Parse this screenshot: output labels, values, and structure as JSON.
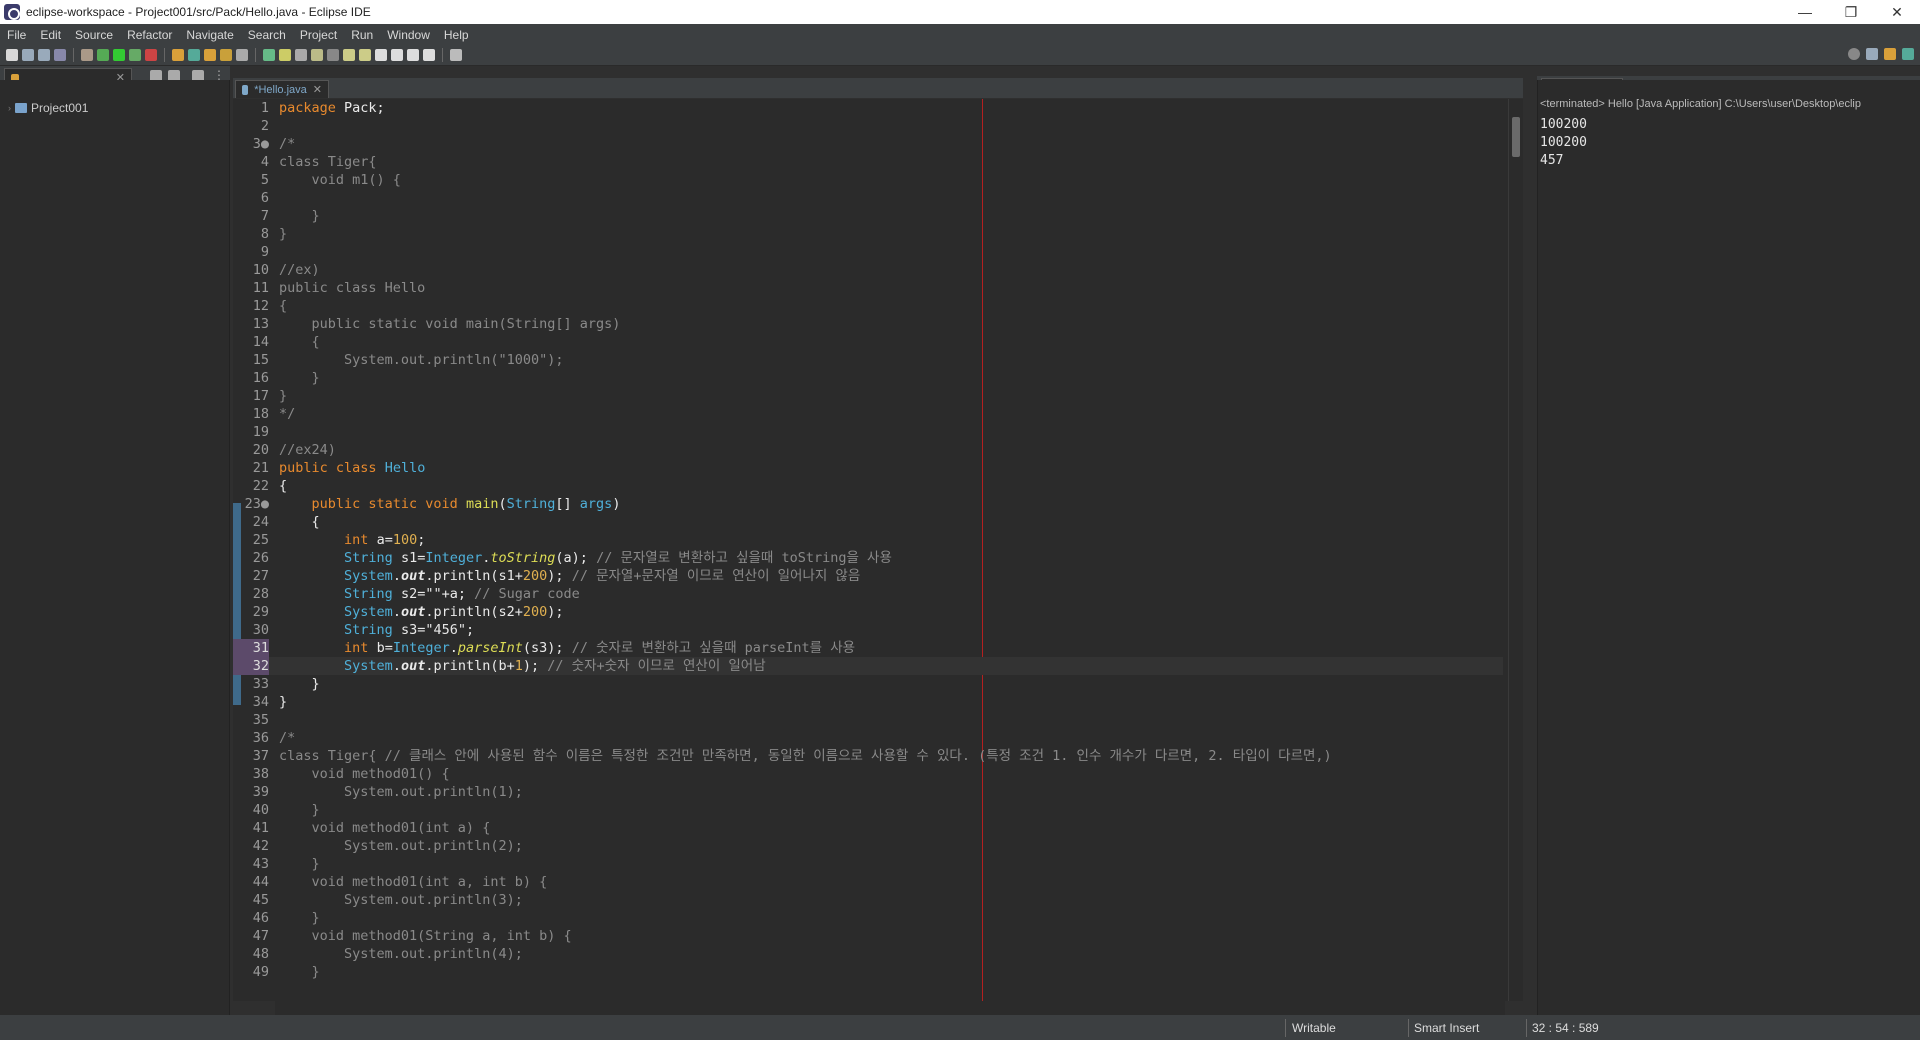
{
  "window": {
    "title": "eclipse-workspace - Project001/src/Pack/Hello.java - Eclipse IDE",
    "minimize": "—",
    "restore": "❐",
    "close": "✕"
  },
  "menu": [
    "File",
    "Edit",
    "Source",
    "Refactor",
    "Navigate",
    "Search",
    "Project",
    "Run",
    "Window",
    "Help"
  ],
  "explorer": {
    "project": "Project001"
  },
  "editor": {
    "tab_label": "*Hello.java"
  },
  "code": [
    {
      "n": "1",
      "t": "package Pack;"
    },
    {
      "n": "2",
      "t": ""
    },
    {
      "n": "3●",
      "t": "/*"
    },
    {
      "n": "4",
      "t": "class Tiger{"
    },
    {
      "n": "5",
      "t": "    void m1() {"
    },
    {
      "n": "6",
      "t": ""
    },
    {
      "n": "7",
      "t": "    }"
    },
    {
      "n": "8",
      "t": "}"
    },
    {
      "n": "9",
      "t": ""
    },
    {
      "n": "10",
      "t": "//ex)"
    },
    {
      "n": "11",
      "t": "public class Hello"
    },
    {
      "n": "12",
      "t": "{"
    },
    {
      "n": "13",
      "t": "    public static void main(String[] args)"
    },
    {
      "n": "14",
      "t": "    {"
    },
    {
      "n": "15",
      "t": "        System.out.println(\"1000\");"
    },
    {
      "n": "16",
      "t": "    }"
    },
    {
      "n": "17",
      "t": "}"
    },
    {
      "n": "18",
      "t": "*/"
    },
    {
      "n": "19",
      "t": ""
    },
    {
      "n": "20",
      "t": "//ex24)"
    },
    {
      "n": "21",
      "t": "public class Hello"
    },
    {
      "n": "22",
      "t": "{"
    },
    {
      "n": "23●",
      "t": "    public static void main(String[] args)"
    },
    {
      "n": "24",
      "t": "    {"
    },
    {
      "n": "25",
      "t": "        int a=100;"
    },
    {
      "n": "26",
      "t": "        String s1=Integer.toString(a); // 문자열로 변환하고 싶을때 toString을 사용"
    },
    {
      "n": "27",
      "t": "        System.out.println(s1+200); // 문자열+문자열 이므로 연산이 일어나지 않음"
    },
    {
      "n": "28",
      "t": "        String s2=\"\"+a; // Sugar code"
    },
    {
      "n": "29",
      "t": "        System.out.println(s2+200);"
    },
    {
      "n": "30",
      "t": "        String s3=\"456\";"
    },
    {
      "n": "31",
      "t": "        int b=Integer.parseInt(s3); // 숫자로 변환하고 싶을때 parseInt를 사용"
    },
    {
      "n": "32",
      "t": "        System.out.println(b+1); // 숫자+숫자 이므로 연산이 일어남"
    },
    {
      "n": "33",
      "t": "    }"
    },
    {
      "n": "34",
      "t": "}"
    },
    {
      "n": "35",
      "t": ""
    },
    {
      "n": "36",
      "t": "/*"
    },
    {
      "n": "37",
      "t": "class Tiger{ // 클래스 안에 사용된 함수 이름은 특정한 조건만 만족하면, 동일한 이름으로 사용할 수 있다. (특정 조건 1. 인수 개수가 다르면, 2. 타입이 다르면,)"
    },
    {
      "n": "38",
      "t": "    void method01() {"
    },
    {
      "n": "39",
      "t": "        System.out.println(1);"
    },
    {
      "n": "40",
      "t": "    }"
    },
    {
      "n": "41",
      "t": "    void method01(int a) {"
    },
    {
      "n": "42",
      "t": "        System.out.println(2);"
    },
    {
      "n": "43",
      "t": "    }"
    },
    {
      "n": "44",
      "t": "    void method01(int a, int b) {"
    },
    {
      "n": "45",
      "t": "        System.out.println(3);"
    },
    {
      "n": "46",
      "t": "    }"
    },
    {
      "n": "47",
      "t": "    void method01(String a, int b) {"
    },
    {
      "n": "48",
      "t": "        System.out.println(4);"
    },
    {
      "n": "49",
      "t": "    }"
    }
  ],
  "console": {
    "header": "<terminated> Hello [Java Application] C:\\Users\\user\\Desktop\\eclip",
    "output": [
      "100200",
      "100200",
      "457"
    ]
  },
  "status": {
    "mode": "Writable",
    "insert": "Smart Insert",
    "position": "32 : 54 : 589"
  }
}
